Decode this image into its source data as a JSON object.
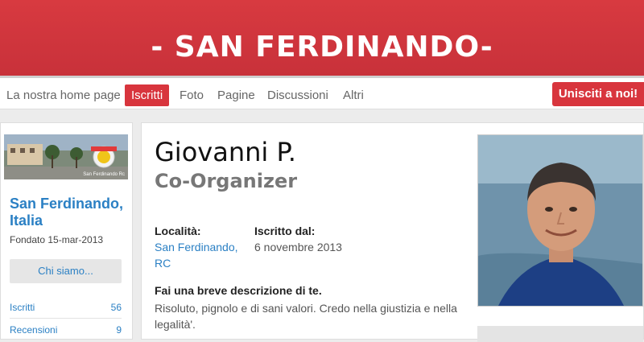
{
  "banner": {
    "title": "- SAN FERDINANDO-"
  },
  "nav": {
    "items": [
      "La nostra home page",
      "Iscritti",
      "Foto",
      "Pagine",
      "Discussioni",
      "Altri"
    ],
    "active": "Iscritti",
    "join_label": "Unisciti a noi!"
  },
  "group": {
    "logo_text": "San Ferdinando Rc",
    "name": "San Ferdinando, Italia",
    "founded": "Fondato 15-mar-2013",
    "about_label": "Chi siamo...",
    "stats": [
      {
        "label": "Iscritti",
        "count": "56"
      },
      {
        "label": "Recensioni",
        "count": "9"
      }
    ]
  },
  "member": {
    "name": "Giovanni P.",
    "role": "Co-Organizer",
    "location_label": "Località:",
    "location_value": "San Ferdinando, RC",
    "joined_label": "Iscritto dal:",
    "joined_value": "6 novembre 2013",
    "desc_question": "Fai una breve descrizione di te.",
    "desc_answer": "Risoluto, pignolo e di sani valori. Credo nella giustizia e nella legalità'."
  },
  "colors": {
    "brand": "#d8353d",
    "link": "#2b80c4"
  }
}
